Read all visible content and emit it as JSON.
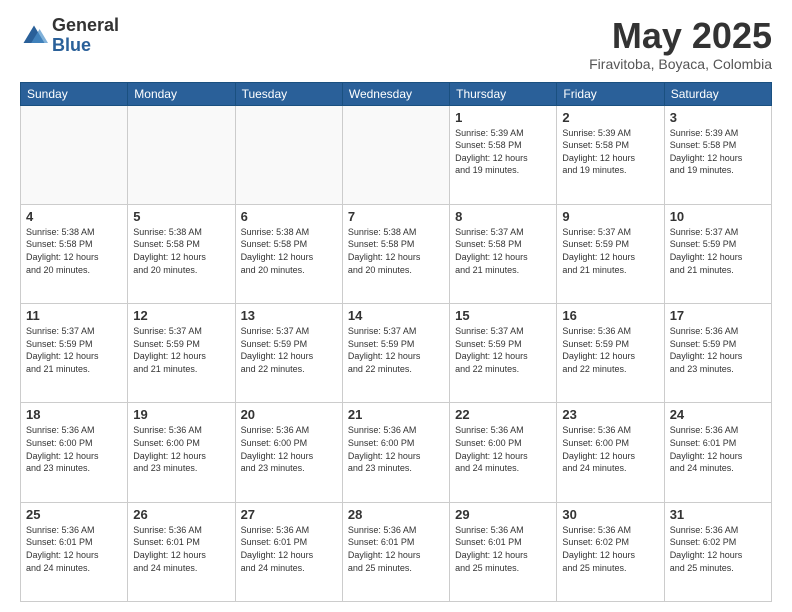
{
  "logo": {
    "general": "General",
    "blue": "Blue"
  },
  "title": "May 2025",
  "location": "Firavitoba, Boyaca, Colombia",
  "days_of_week": [
    "Sunday",
    "Monday",
    "Tuesday",
    "Wednesday",
    "Thursday",
    "Friday",
    "Saturday"
  ],
  "weeks": [
    [
      {
        "day": "",
        "info": ""
      },
      {
        "day": "",
        "info": ""
      },
      {
        "day": "",
        "info": ""
      },
      {
        "day": "",
        "info": ""
      },
      {
        "day": "1",
        "info": "Sunrise: 5:39 AM\nSunset: 5:58 PM\nDaylight: 12 hours\nand 19 minutes."
      },
      {
        "day": "2",
        "info": "Sunrise: 5:39 AM\nSunset: 5:58 PM\nDaylight: 12 hours\nand 19 minutes."
      },
      {
        "day": "3",
        "info": "Sunrise: 5:39 AM\nSunset: 5:58 PM\nDaylight: 12 hours\nand 19 minutes."
      }
    ],
    [
      {
        "day": "4",
        "info": "Sunrise: 5:38 AM\nSunset: 5:58 PM\nDaylight: 12 hours\nand 20 minutes."
      },
      {
        "day": "5",
        "info": "Sunrise: 5:38 AM\nSunset: 5:58 PM\nDaylight: 12 hours\nand 20 minutes."
      },
      {
        "day": "6",
        "info": "Sunrise: 5:38 AM\nSunset: 5:58 PM\nDaylight: 12 hours\nand 20 minutes."
      },
      {
        "day": "7",
        "info": "Sunrise: 5:38 AM\nSunset: 5:58 PM\nDaylight: 12 hours\nand 20 minutes."
      },
      {
        "day": "8",
        "info": "Sunrise: 5:37 AM\nSunset: 5:58 PM\nDaylight: 12 hours\nand 21 minutes."
      },
      {
        "day": "9",
        "info": "Sunrise: 5:37 AM\nSunset: 5:59 PM\nDaylight: 12 hours\nand 21 minutes."
      },
      {
        "day": "10",
        "info": "Sunrise: 5:37 AM\nSunset: 5:59 PM\nDaylight: 12 hours\nand 21 minutes."
      }
    ],
    [
      {
        "day": "11",
        "info": "Sunrise: 5:37 AM\nSunset: 5:59 PM\nDaylight: 12 hours\nand 21 minutes."
      },
      {
        "day": "12",
        "info": "Sunrise: 5:37 AM\nSunset: 5:59 PM\nDaylight: 12 hours\nand 21 minutes."
      },
      {
        "day": "13",
        "info": "Sunrise: 5:37 AM\nSunset: 5:59 PM\nDaylight: 12 hours\nand 22 minutes."
      },
      {
        "day": "14",
        "info": "Sunrise: 5:37 AM\nSunset: 5:59 PM\nDaylight: 12 hours\nand 22 minutes."
      },
      {
        "day": "15",
        "info": "Sunrise: 5:37 AM\nSunset: 5:59 PM\nDaylight: 12 hours\nand 22 minutes."
      },
      {
        "day": "16",
        "info": "Sunrise: 5:36 AM\nSunset: 5:59 PM\nDaylight: 12 hours\nand 22 minutes."
      },
      {
        "day": "17",
        "info": "Sunrise: 5:36 AM\nSunset: 5:59 PM\nDaylight: 12 hours\nand 23 minutes."
      }
    ],
    [
      {
        "day": "18",
        "info": "Sunrise: 5:36 AM\nSunset: 6:00 PM\nDaylight: 12 hours\nand 23 minutes."
      },
      {
        "day": "19",
        "info": "Sunrise: 5:36 AM\nSunset: 6:00 PM\nDaylight: 12 hours\nand 23 minutes."
      },
      {
        "day": "20",
        "info": "Sunrise: 5:36 AM\nSunset: 6:00 PM\nDaylight: 12 hours\nand 23 minutes."
      },
      {
        "day": "21",
        "info": "Sunrise: 5:36 AM\nSunset: 6:00 PM\nDaylight: 12 hours\nand 23 minutes."
      },
      {
        "day": "22",
        "info": "Sunrise: 5:36 AM\nSunset: 6:00 PM\nDaylight: 12 hours\nand 24 minutes."
      },
      {
        "day": "23",
        "info": "Sunrise: 5:36 AM\nSunset: 6:00 PM\nDaylight: 12 hours\nand 24 minutes."
      },
      {
        "day": "24",
        "info": "Sunrise: 5:36 AM\nSunset: 6:01 PM\nDaylight: 12 hours\nand 24 minutes."
      }
    ],
    [
      {
        "day": "25",
        "info": "Sunrise: 5:36 AM\nSunset: 6:01 PM\nDaylight: 12 hours\nand 24 minutes."
      },
      {
        "day": "26",
        "info": "Sunrise: 5:36 AM\nSunset: 6:01 PM\nDaylight: 12 hours\nand 24 minutes."
      },
      {
        "day": "27",
        "info": "Sunrise: 5:36 AM\nSunset: 6:01 PM\nDaylight: 12 hours\nand 24 minutes."
      },
      {
        "day": "28",
        "info": "Sunrise: 5:36 AM\nSunset: 6:01 PM\nDaylight: 12 hours\nand 25 minutes."
      },
      {
        "day": "29",
        "info": "Sunrise: 5:36 AM\nSunset: 6:01 PM\nDaylight: 12 hours\nand 25 minutes."
      },
      {
        "day": "30",
        "info": "Sunrise: 5:36 AM\nSunset: 6:02 PM\nDaylight: 12 hours\nand 25 minutes."
      },
      {
        "day": "31",
        "info": "Sunrise: 5:36 AM\nSunset: 6:02 PM\nDaylight: 12 hours\nand 25 minutes."
      }
    ]
  ]
}
